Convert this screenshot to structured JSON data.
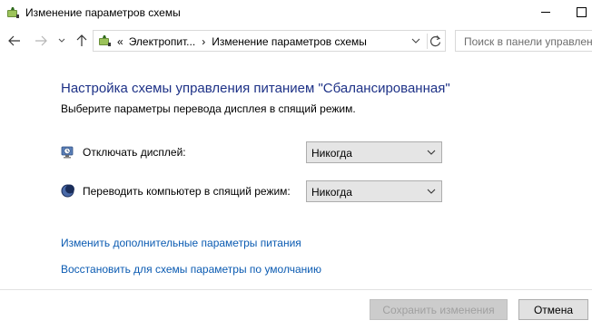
{
  "window": {
    "title": "Изменение параметров схемы"
  },
  "address": {
    "overflow": "«",
    "crumb1": "Электропит...",
    "separator": "›",
    "crumb2": "Изменение параметров схемы"
  },
  "search": {
    "placeholder": "Поиск в панели управлен"
  },
  "main": {
    "title": "Настройка схемы управления питанием \"Сбалансированная\"",
    "subtitle": "Выберите параметры перевода дисплея в спящий режим."
  },
  "settings": {
    "display": {
      "label": "Отключать дисплей:",
      "value": "Никогда",
      "icon": "monitor-clock-icon"
    },
    "sleep": {
      "label": "Переводить компьютер в спящий режим:",
      "value": "Никогда",
      "icon": "moon-icon"
    }
  },
  "links": {
    "advanced": "Изменить дополнительные параметры питания",
    "restore": "Восстановить для схемы параметры по умолчанию"
  },
  "buttons": {
    "save": "Сохранить изменения",
    "cancel": "Отмена"
  },
  "colors": {
    "title_blue": "#1e3287",
    "link_blue": "#0b5bb2",
    "disabled_text": "#a0a0a0"
  }
}
